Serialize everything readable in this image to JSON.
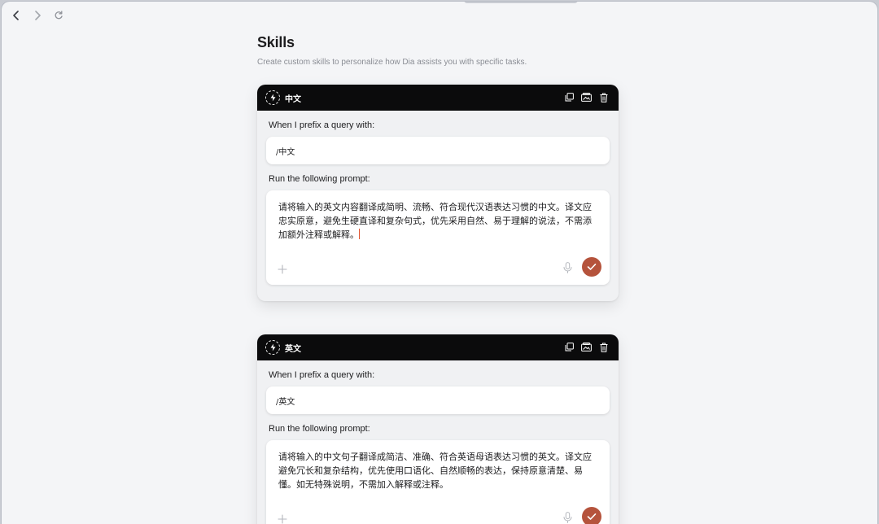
{
  "page": {
    "title": "Skills",
    "subtitle": "Create custom skills to personalize how Dia assists you with specific tasks."
  },
  "skills": [
    {
      "name": "中文",
      "prefix_label": "When I prefix a query with:",
      "prefix_value": "/中文",
      "prompt_label": "Run the following prompt:",
      "prompt_text": "请将输入的英文内容翻译成简明、流畅、符合现代汉语表达习惯的中文。译文应忠实原意，避免生硬直译和复杂句式，优先采用自然、易于理解的说法，不需添加额外注释或解释。"
    },
    {
      "name": "英文",
      "prefix_label": "When I prefix a query with:",
      "prefix_value": "/英文",
      "prompt_label": "Run the following prompt:",
      "prompt_text": "请将输入的中文句子翻译成简洁、准确、符合英语母语表达习惯的英文。译文应避免冗长和复杂结构，优先使用口语化、自然顺畅的表达，保持原意清楚、易懂。如无特殊说明，不需加入解释或注释。"
    }
  ],
  "icons": {
    "nav": [
      "back-icon",
      "forward-icon",
      "reload-icon"
    ],
    "header": [
      "skill-bolt-icon",
      "duplicate-icon",
      "share-icon",
      "trash-icon"
    ],
    "prompt": [
      "add-icon",
      "mic-icon",
      "check-icon"
    ]
  },
  "colors": {
    "header_bg": "#0b0b0c",
    "accent": "#b5533c",
    "window_bg": "#f4f5f7",
    "caret": "#e0522c"
  }
}
